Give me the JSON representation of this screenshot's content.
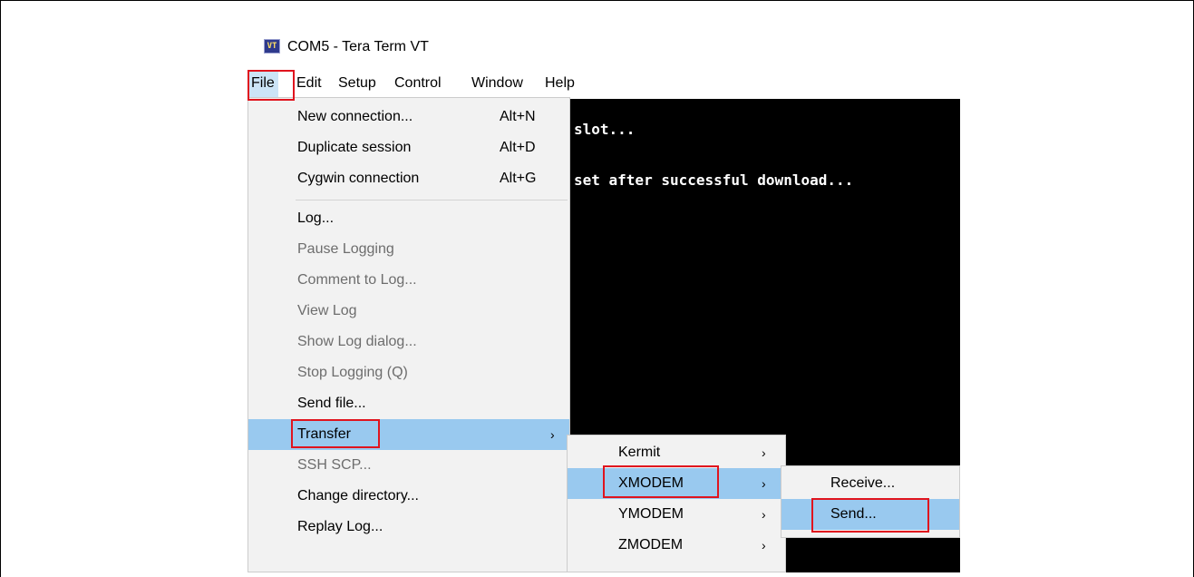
{
  "window": {
    "icon_text": "VT",
    "title": "COM5 - Tera Term VT"
  },
  "menubar": {
    "items": [
      "File",
      "Edit",
      "Setup",
      "Control",
      "Window",
      "Help"
    ]
  },
  "terminal": {
    "lines": [
      "slot...",
      "set after successful download..."
    ]
  },
  "file_menu": {
    "items": [
      {
        "label": "New connection...",
        "shortcut": "Alt+N",
        "enabled": true
      },
      {
        "label": "Duplicate session",
        "shortcut": "Alt+D",
        "enabled": true
      },
      {
        "label": "Cygwin connection",
        "shortcut": "Alt+G",
        "enabled": true
      },
      {
        "label": "Log...",
        "shortcut": "",
        "enabled": true
      },
      {
        "label": "Pause Logging",
        "shortcut": "",
        "enabled": false
      },
      {
        "label": "Comment to Log...",
        "shortcut": "",
        "enabled": false
      },
      {
        "label": "View Log",
        "shortcut": "",
        "enabled": false
      },
      {
        "label": "Show Log dialog...",
        "shortcut": "",
        "enabled": false
      },
      {
        "label": "Stop Logging (Q)",
        "shortcut": "",
        "enabled": false
      },
      {
        "label": "Send file...",
        "shortcut": "",
        "enabled": true
      },
      {
        "label": "Transfer",
        "shortcut": "",
        "enabled": true,
        "submenu_arrow": "›"
      },
      {
        "label": "SSH SCP...",
        "shortcut": "",
        "enabled": false
      },
      {
        "label": "Change directory...",
        "shortcut": "",
        "enabled": true
      },
      {
        "label": "Replay Log...",
        "shortcut": "",
        "enabled": true
      }
    ]
  },
  "transfer_menu": {
    "items": [
      {
        "label": "Kermit",
        "arrow": "›"
      },
      {
        "label": "XMODEM",
        "arrow": "›"
      },
      {
        "label": "YMODEM",
        "arrow": "›"
      },
      {
        "label": "ZMODEM",
        "arrow": "›"
      }
    ]
  },
  "xmodem_menu": {
    "items": [
      {
        "label": "Receive..."
      },
      {
        "label": "Send..."
      }
    ]
  },
  "colors": {
    "highlight": "#99c9ef",
    "annotation_red": "#e0141e",
    "menu_bg": "#f2f2f2",
    "terminal_bg": "#000000"
  }
}
